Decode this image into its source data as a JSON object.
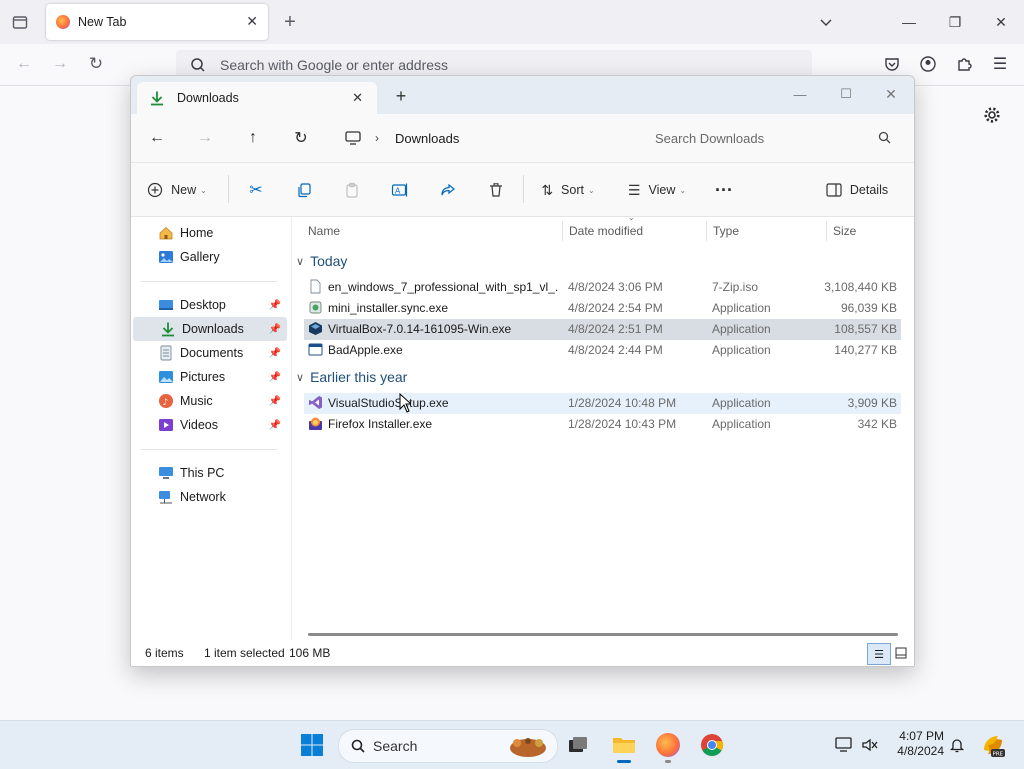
{
  "browser": {
    "tab_title": "New Tab",
    "url_placeholder": "Search with Google or enter address"
  },
  "explorer": {
    "tab_title": "Downloads",
    "breadcrumb": "Downloads",
    "search_placeholder": "Search Downloads",
    "commands": {
      "new": "New",
      "sort": "Sort",
      "view": "View",
      "details": "Details"
    },
    "sidebar": {
      "home": "Home",
      "gallery": "Gallery",
      "desktop": "Desktop",
      "downloads": "Downloads",
      "documents": "Documents",
      "pictures": "Pictures",
      "music": "Music",
      "videos": "Videos",
      "this_pc": "This PC",
      "network": "Network"
    },
    "columns": {
      "name": "Name",
      "date": "Date modified",
      "type": "Type",
      "size": "Size"
    },
    "groups": {
      "today": "Today",
      "earlier": "Earlier this year"
    },
    "files": [
      {
        "name": "en_windows_7_professional_with_sp1_vl_...",
        "date": "4/8/2024 3:06 PM",
        "type": "7-Zip.iso",
        "size": "3,108,440 KB"
      },
      {
        "name": "mini_installer.sync.exe",
        "date": "4/8/2024 2:54 PM",
        "type": "Application",
        "size": "96,039 KB"
      },
      {
        "name": "VirtualBox-7.0.14-161095-Win.exe",
        "date": "4/8/2024 2:51 PM",
        "type": "Application",
        "size": "108,557 KB"
      },
      {
        "name": "BadApple.exe",
        "date": "4/8/2024 2:44 PM",
        "type": "Application",
        "size": "140,277 KB"
      },
      {
        "name": "VisualStudioSetup.exe",
        "date": "1/28/2024 10:48 PM",
        "type": "Application",
        "size": "3,909 KB"
      },
      {
        "name": "Firefox Installer.exe",
        "date": "1/28/2024 10:43 PM",
        "type": "Application",
        "size": "342 KB"
      }
    ],
    "status": {
      "items": "6 items",
      "selected": "1 item selected",
      "size": "106 MB"
    }
  },
  "taskbar": {
    "search_label": "Search",
    "time": "4:07 PM",
    "date": "4/8/2024"
  },
  "colors": {
    "win_blue": "#0067c0",
    "selection": "#d8dde3",
    "accent_green": "#1e8c3a"
  }
}
